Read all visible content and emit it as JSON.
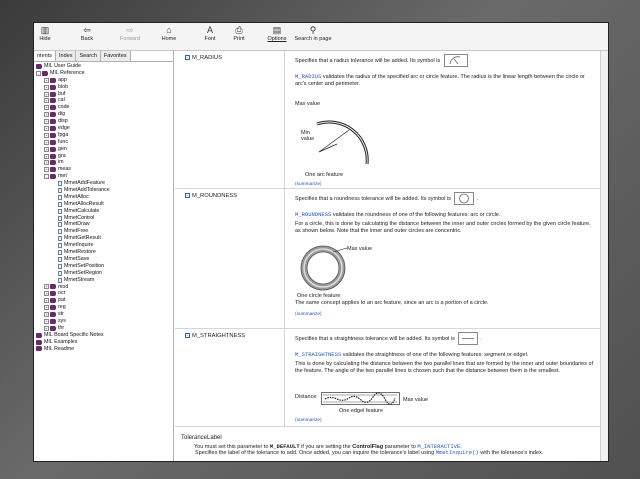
{
  "toolbar": {
    "hide": "Hide",
    "back": "Back",
    "forward": "Forward",
    "home": "Home",
    "font": "Font",
    "print": "Print",
    "options": "Options",
    "search": "Search in page"
  },
  "nav": {
    "tabs": [
      "ntents",
      "Index",
      "Search",
      "Favorites"
    ],
    "tree": [
      {
        "label": "MIL User Guide",
        "level": 0,
        "kind": "book",
        "exp": ""
      },
      {
        "label": "MIL Reference",
        "level": 0,
        "kind": "book",
        "exp": "-"
      },
      {
        "label": "app",
        "level": 1,
        "kind": "book",
        "exp": "+"
      },
      {
        "label": "blob",
        "level": 1,
        "kind": "book",
        "exp": "+"
      },
      {
        "label": "buf",
        "level": 1,
        "kind": "book",
        "exp": "+"
      },
      {
        "label": "cal",
        "level": 1,
        "kind": "book",
        "exp": "+"
      },
      {
        "label": "code",
        "level": 1,
        "kind": "book",
        "exp": "+"
      },
      {
        "label": "dig",
        "level": 1,
        "kind": "book",
        "exp": "+"
      },
      {
        "label": "disp",
        "level": 1,
        "kind": "book",
        "exp": "+"
      },
      {
        "label": "edge",
        "level": 1,
        "kind": "book",
        "exp": "+"
      },
      {
        "label": "fpga",
        "level": 1,
        "kind": "book",
        "exp": "+"
      },
      {
        "label": "func",
        "level": 1,
        "kind": "book",
        "exp": "+"
      },
      {
        "label": "gen",
        "level": 1,
        "kind": "book",
        "exp": "+"
      },
      {
        "label": "gra",
        "level": 1,
        "kind": "book",
        "exp": "+"
      },
      {
        "label": "im",
        "level": 1,
        "kind": "book",
        "exp": "+"
      },
      {
        "label": "meas",
        "level": 1,
        "kind": "book",
        "exp": "+"
      },
      {
        "label": "met",
        "level": 1,
        "kind": "book",
        "exp": "-"
      },
      {
        "label": "MmetAddFeature",
        "level": 2,
        "kind": "page",
        "exp": ""
      },
      {
        "label": "MmetAddTolerance",
        "level": 2,
        "kind": "page",
        "exp": ""
      },
      {
        "label": "MmetAlloc",
        "level": 2,
        "kind": "page",
        "exp": ""
      },
      {
        "label": "MmetAllocResult",
        "level": 2,
        "kind": "page",
        "exp": ""
      },
      {
        "label": "MmetCalculate",
        "level": 2,
        "kind": "page",
        "exp": ""
      },
      {
        "label": "MmetControl",
        "level": 2,
        "kind": "page",
        "exp": ""
      },
      {
        "label": "MmetDraw",
        "level": 2,
        "kind": "page",
        "exp": ""
      },
      {
        "label": "MmetFree",
        "level": 2,
        "kind": "page",
        "exp": ""
      },
      {
        "label": "MmetGetResult",
        "level": 2,
        "kind": "page",
        "exp": ""
      },
      {
        "label": "MmetInquire",
        "level": 2,
        "kind": "page",
        "exp": ""
      },
      {
        "label": "MmetRestore",
        "level": 2,
        "kind": "page",
        "exp": ""
      },
      {
        "label": "MmetSave",
        "level": 2,
        "kind": "page",
        "exp": ""
      },
      {
        "label": "MmetSetPosition",
        "level": 2,
        "kind": "page",
        "exp": ""
      },
      {
        "label": "MmetSetRegion",
        "level": 2,
        "kind": "page",
        "exp": ""
      },
      {
        "label": "MmetStream",
        "level": 2,
        "kind": "page",
        "exp": ""
      },
      {
        "label": "mod",
        "level": 1,
        "kind": "book",
        "exp": "+"
      },
      {
        "label": "ocr",
        "level": 1,
        "kind": "book",
        "exp": "+"
      },
      {
        "label": "pat",
        "level": 1,
        "kind": "book",
        "exp": "+"
      },
      {
        "label": "reg",
        "level": 1,
        "kind": "book",
        "exp": "+"
      },
      {
        "label": "str",
        "level": 1,
        "kind": "book",
        "exp": "+"
      },
      {
        "label": "sys",
        "level": 1,
        "kind": "book",
        "exp": "+"
      },
      {
        "label": "thr",
        "level": 1,
        "kind": "book",
        "exp": "+"
      },
      {
        "label": "MIL Board Specific Notes",
        "level": 0,
        "kind": "book",
        "exp": ""
      },
      {
        "label": "MIL Examples",
        "level": 0,
        "kind": "book",
        "exp": ""
      },
      {
        "label": "MIL Readme",
        "level": 0,
        "kind": "book",
        "exp": ""
      }
    ]
  },
  "content": {
    "radius": {
      "name": "M_RADIUS",
      "line1": "Specifies that a radius tolerance will be added. Its symbol is",
      "detail_link": "M_RADIUS",
      "detail": " validates the radius of the specified arc or circle feature. The radius is the linear length between the circle or arc's center and perimeter.",
      "max_label": "Max value",
      "min_label": "Min value",
      "feature_label": "One arc feature",
      "summarize": "(summarize)"
    },
    "roundness": {
      "name": "M_ROUNDNESS",
      "line1": "Specifies that a roundness tolerance will be added. Its symbol is",
      "detail_link": "M_ROUNDNESS",
      "detail": " validates the roundness of one of the following features: arc or circle.",
      "detail2": "For a circle, this is done by calculating the distance between the inner and outer circles formed by the given circle feature, as shown below. Note that the inner and outer circles are concentric.",
      "max_label": "Max value",
      "feature_label": "One circle feature",
      "note": "The same concept applies to an arc feature, since an arc is a portion of a circle.",
      "summarize": "(summarize)"
    },
    "straightness": {
      "name": "M_STRAIGHTNESS",
      "line1": "Specifies that a straightness tolerance will be added. Its symbol is",
      "detail_link": "M_STRAIGHTNESS",
      "detail": " validates the straightness of one of the following features: segment or edgel.",
      "detail2": "This is done by calculating the distance between the two parallel lines that are formed by the inner and outer boundaries of the feature. The angle of the two parallel lines is chosen such that the distance between them is the smallest.",
      "distance_label": "Distance",
      "max_label": "Max value",
      "feature_label": "One edgel feature",
      "summarize": "(summarize)"
    },
    "tolerance_label": {
      "heading": "ToleranceLabel",
      "text1_a": "Specifies the label of the tolerance to add. Once added, you can inquire the tolerance's label using ",
      "text1_link": "MmetInquire()",
      "text1_b": " with the tolerance's index.",
      "text2_a": "You must set this parameter to ",
      "text2_bold": "M_DEFAULT",
      "text2_b": " if you are setting the ",
      "text2_bold2": "ControlFlag",
      "text2_c": " parameter to ",
      "text2_link": "M_INTERACTIVE",
      "text2_d": "."
    }
  }
}
